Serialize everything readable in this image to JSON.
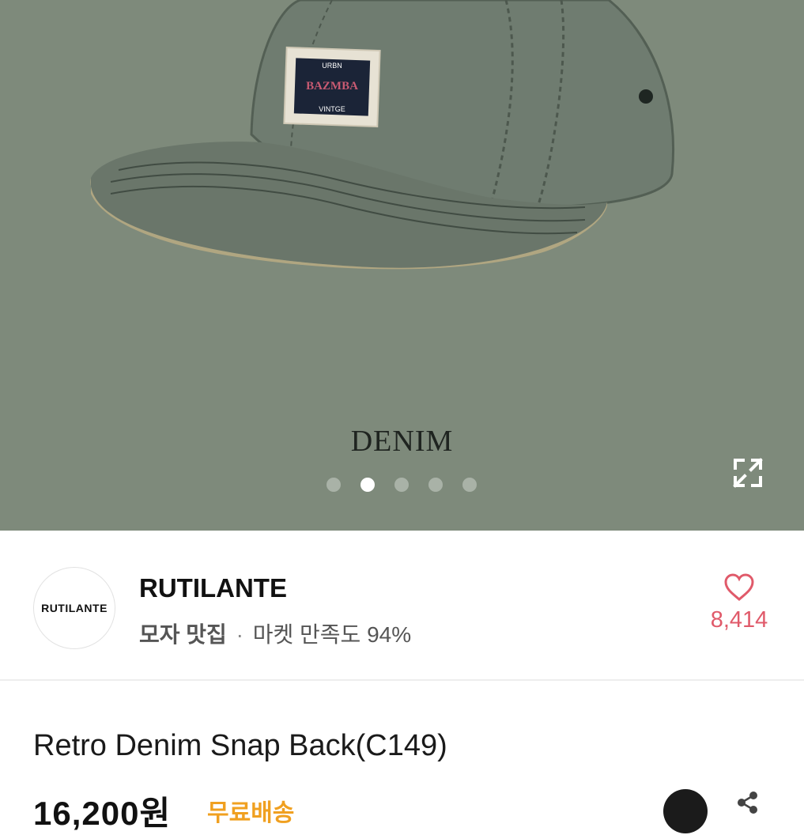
{
  "hero": {
    "caption": "DENIM",
    "patch_top": "URBN",
    "patch_main": "BAZMBA",
    "patch_bottom": "VINTGE",
    "slide_count": 5,
    "active_slide": 2
  },
  "seller": {
    "avatar_text": "RUTILANTE",
    "name": "RUTILANTE",
    "category": "모자 맛집",
    "separator": "·",
    "satisfaction": "마켓 만족도 94%",
    "likes": "8,414"
  },
  "product": {
    "title": "Retro Denim Snap Back(C149)",
    "price": "16,200원",
    "shipping": "무료배송"
  },
  "colors": {
    "hero_bg": "#7e8a7b",
    "accent_pink": "#e05a6a",
    "shipping_orange": "#f0a020"
  }
}
